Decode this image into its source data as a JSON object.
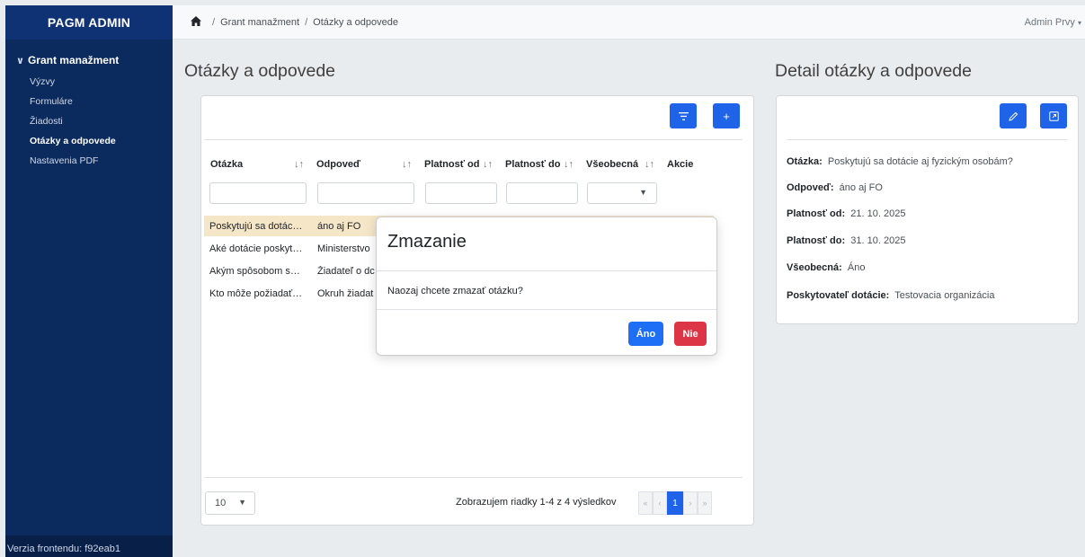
{
  "app": {
    "brand": "PAGM ADMIN",
    "version_text": "Verzia frontendu: f92eab1"
  },
  "sidebar": {
    "group_label": "Grant manažment",
    "items": [
      {
        "label": "Výzvy"
      },
      {
        "label": "Formuláre"
      },
      {
        "label": "Žiadosti"
      },
      {
        "label": "Otázky a odpovede"
      },
      {
        "label": "Nastavenia PDF"
      }
    ]
  },
  "breadcrumb": {
    "items": [
      "Grant manažment",
      "Otázky a odpovede"
    ]
  },
  "user": {
    "name": "Admin Prvy"
  },
  "list": {
    "title": "Otázky a odpovede",
    "columns": [
      "Otázka",
      "Odpoveď",
      "Platnosť od",
      "Platnosť do",
      "Všeobecná",
      "Akcie"
    ],
    "rows": [
      {
        "question": "Poskytujú sa dotác…",
        "answer": "áno aj FO"
      },
      {
        "question": "Aké dotácie poskyt…",
        "answer": "Ministerstvo"
      },
      {
        "question": "Akým spôsobom s…",
        "answer": "Žiadateľ o dc"
      },
      {
        "question": "Kto môže požiadať…",
        "answer": "Okruh žiadat"
      }
    ],
    "page_size": "10",
    "info": "Zobrazujem riadky 1-4 z 4 výsledkov",
    "current_page": "1"
  },
  "detail": {
    "title": "Detail otázky a odpovede",
    "fields": [
      {
        "label": "Otázka:",
        "value": "Poskytujú sa dotácie aj fyzickým osobám?"
      },
      {
        "label": "Odpoveď:",
        "value": "áno aj FO"
      },
      {
        "label": "Platnosť od:",
        "value": "21. 10. 2025"
      },
      {
        "label": "Platnosť do:",
        "value": "31. 10. 2025"
      },
      {
        "label": "Všeobecná:",
        "value": "Áno"
      },
      {
        "label": "Poskytovateľ dotácie:",
        "value": "Testovacia organizácia"
      }
    ]
  },
  "modal": {
    "title": "Zmazanie",
    "message": "Naozaj chcete zmazať otázku?",
    "confirm_label": "Áno",
    "cancel_label": "Nie"
  },
  "colors": {
    "sidebar": "#0b2a5e",
    "primary": "#1f63e8",
    "danger": "#dc3545",
    "selected_row": "#f5e6c8"
  }
}
